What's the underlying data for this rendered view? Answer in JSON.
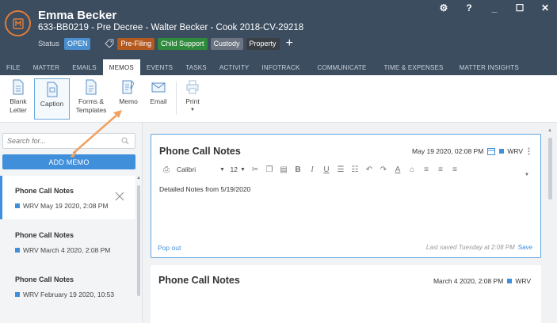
{
  "header": {
    "client_name": "Emma Becker",
    "matter_title": "633-BB0219 - Pre Decree - Walter Becker - Cook 2018-CV-29218",
    "status_label": "Status",
    "status_value": "OPEN",
    "tags": [
      {
        "label": "Pre-Filing",
        "color": "#b55a1f"
      },
      {
        "label": "Child Support",
        "color": "#2e8b3c"
      },
      {
        "label": "Custody",
        "color": "#6b7480"
      },
      {
        "label": "Property",
        "color": "#3a3f45"
      }
    ],
    "window_controls": {
      "help": "?",
      "minimize": "_",
      "maximize": "☐",
      "close": "✕"
    }
  },
  "tabs": [
    {
      "label": "FILE"
    },
    {
      "label": "MATTER"
    },
    {
      "label": "EMAILS"
    },
    {
      "label": "MEMOS",
      "active": true
    },
    {
      "label": "EVENTS"
    },
    {
      "label": "TASKS"
    },
    {
      "label": "ACTIVITY"
    },
    {
      "label": "INFOTRACK"
    },
    {
      "label": "COMMUNICATE"
    },
    {
      "label": "TIME & EXPENSES"
    },
    {
      "label": "MATTER INSIGHTS"
    }
  ],
  "ribbon": {
    "blank_letter": {
      "line1": "Blank",
      "line2": "Letter"
    },
    "caption": "Caption",
    "forms": {
      "line1": "Forms &",
      "line2": "Templates"
    },
    "memo": "Memo",
    "email": "Email",
    "print": "Print"
  },
  "left_panel": {
    "search_placeholder": "Search for...",
    "add_memo_label": "ADD MEMO",
    "memos": [
      {
        "title": "Phone Call Notes",
        "meta": "WRV May 19 2020, 2:08 PM",
        "active": true
      },
      {
        "title": "Phone Call Notes",
        "meta": "WRV March 4 2020, 2:08 PM"
      },
      {
        "title": "Phone Call Notes",
        "meta": "WRV February 19 2020, 10:53"
      }
    ]
  },
  "editor": {
    "title": "Phone Call Notes",
    "date": "May 19 2020, 02:08 PM",
    "author": "WRV",
    "font": "Calibri",
    "font_size": "12",
    "body": "Detailed Notes from 5/19/2020",
    "popout_label": "Pop out",
    "saved_text": "Last saved Tuesday at 2:08 PM",
    "save_label": "Save"
  },
  "second_memo": {
    "title": "Phone Call Notes",
    "date": "March 4 2020, 2:08 PM",
    "author": "WRV"
  },
  "colors": {
    "header_bg": "#3c4d60",
    "accent": "#3f8fdb",
    "annotation": "#f0a060"
  }
}
